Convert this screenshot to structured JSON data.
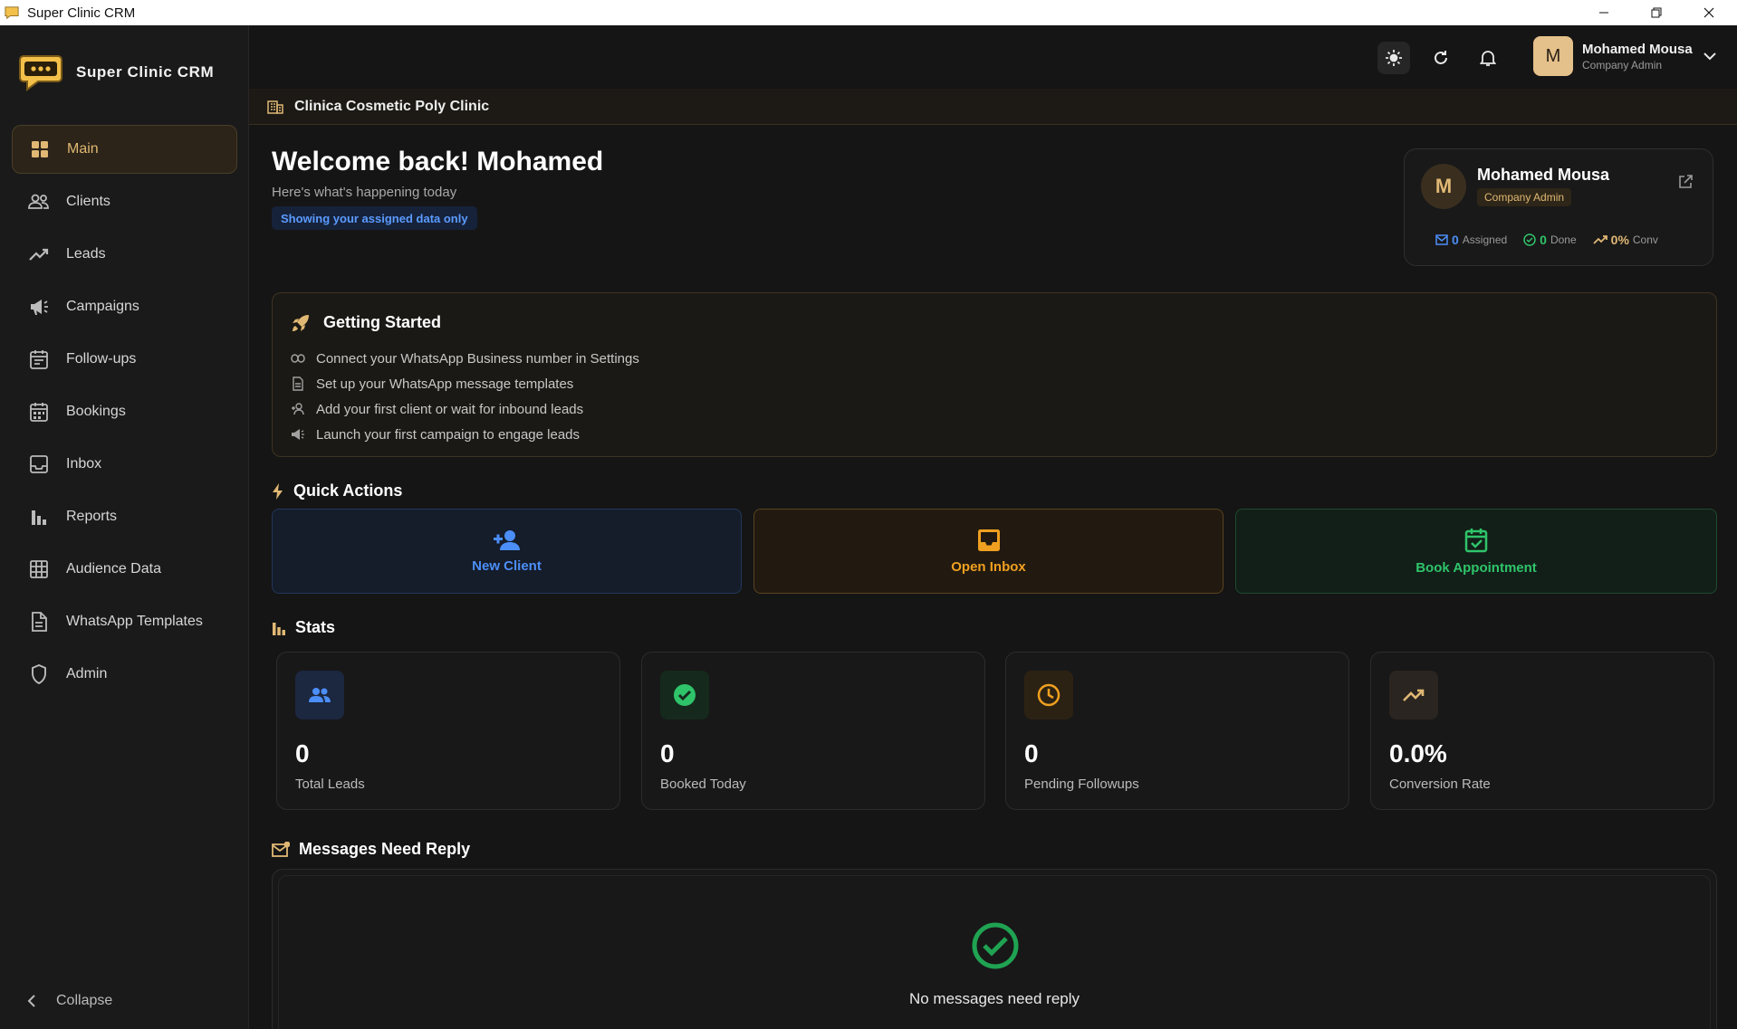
{
  "window": {
    "title": "Super Clinic CRM"
  },
  "brand": {
    "name": "Super Clinic CRM"
  },
  "sidebar": {
    "items": [
      {
        "label": "Main",
        "icon": "grid-icon",
        "active": true
      },
      {
        "label": "Clients",
        "icon": "users-icon"
      },
      {
        "label": "Leads",
        "icon": "trend-icon"
      },
      {
        "label": "Campaigns",
        "icon": "megaphone-icon"
      },
      {
        "label": "Follow-ups",
        "icon": "calendar-icon"
      },
      {
        "label": "Bookings",
        "icon": "calendar-grid-icon"
      },
      {
        "label": "Inbox",
        "icon": "inbox-icon"
      },
      {
        "label": "Reports",
        "icon": "bar-chart-icon"
      },
      {
        "label": "Audience Data",
        "icon": "table-icon"
      },
      {
        "label": "WhatsApp Templates",
        "icon": "document-icon"
      },
      {
        "label": "Admin",
        "icon": "shield-icon"
      }
    ],
    "collapse_label": "Collapse"
  },
  "header": {
    "user_initial": "M",
    "user_name": "Mohamed Mousa",
    "user_role": "Company Admin"
  },
  "clinic": {
    "name": "Clinica Cosmetic Poly Clinic"
  },
  "welcome": {
    "title": "Welcome back! Mohamed",
    "subtitle": "Here's what's happening today",
    "badge": "Showing your assigned data only"
  },
  "profile_card": {
    "initial": "M",
    "name": "Mohamed Mousa",
    "role": "Company Admin",
    "assigned_value": "0",
    "assigned_label": "Assigned",
    "done_value": "0",
    "done_label": "Done",
    "conv_value": "0%",
    "conv_label": "Conv"
  },
  "getting_started": {
    "title": "Getting Started",
    "items": [
      "Connect your WhatsApp Business number in Settings",
      "Set up your WhatsApp message templates",
      "Add your first client or wait for inbound leads",
      "Launch your first campaign to engage leads"
    ]
  },
  "quick_actions": {
    "title": "Quick Actions",
    "new_client": "New Client",
    "open_inbox": "Open Inbox",
    "book_appointment": "Book Appointment"
  },
  "stats": {
    "title": "Stats",
    "cards": [
      {
        "value": "0",
        "label": "Total Leads"
      },
      {
        "value": "0",
        "label": "Booked Today"
      },
      {
        "value": "0",
        "label": "Pending Followups"
      },
      {
        "value": "0.0%",
        "label": "Conversion Rate"
      }
    ]
  },
  "messages": {
    "title": "Messages Need Reply",
    "empty_text": "No messages need reply"
  },
  "colors": {
    "accent_gold": "#e0b874",
    "blue": "#4c8ef7",
    "amber": "#f0a020",
    "green": "#2fc46a"
  }
}
